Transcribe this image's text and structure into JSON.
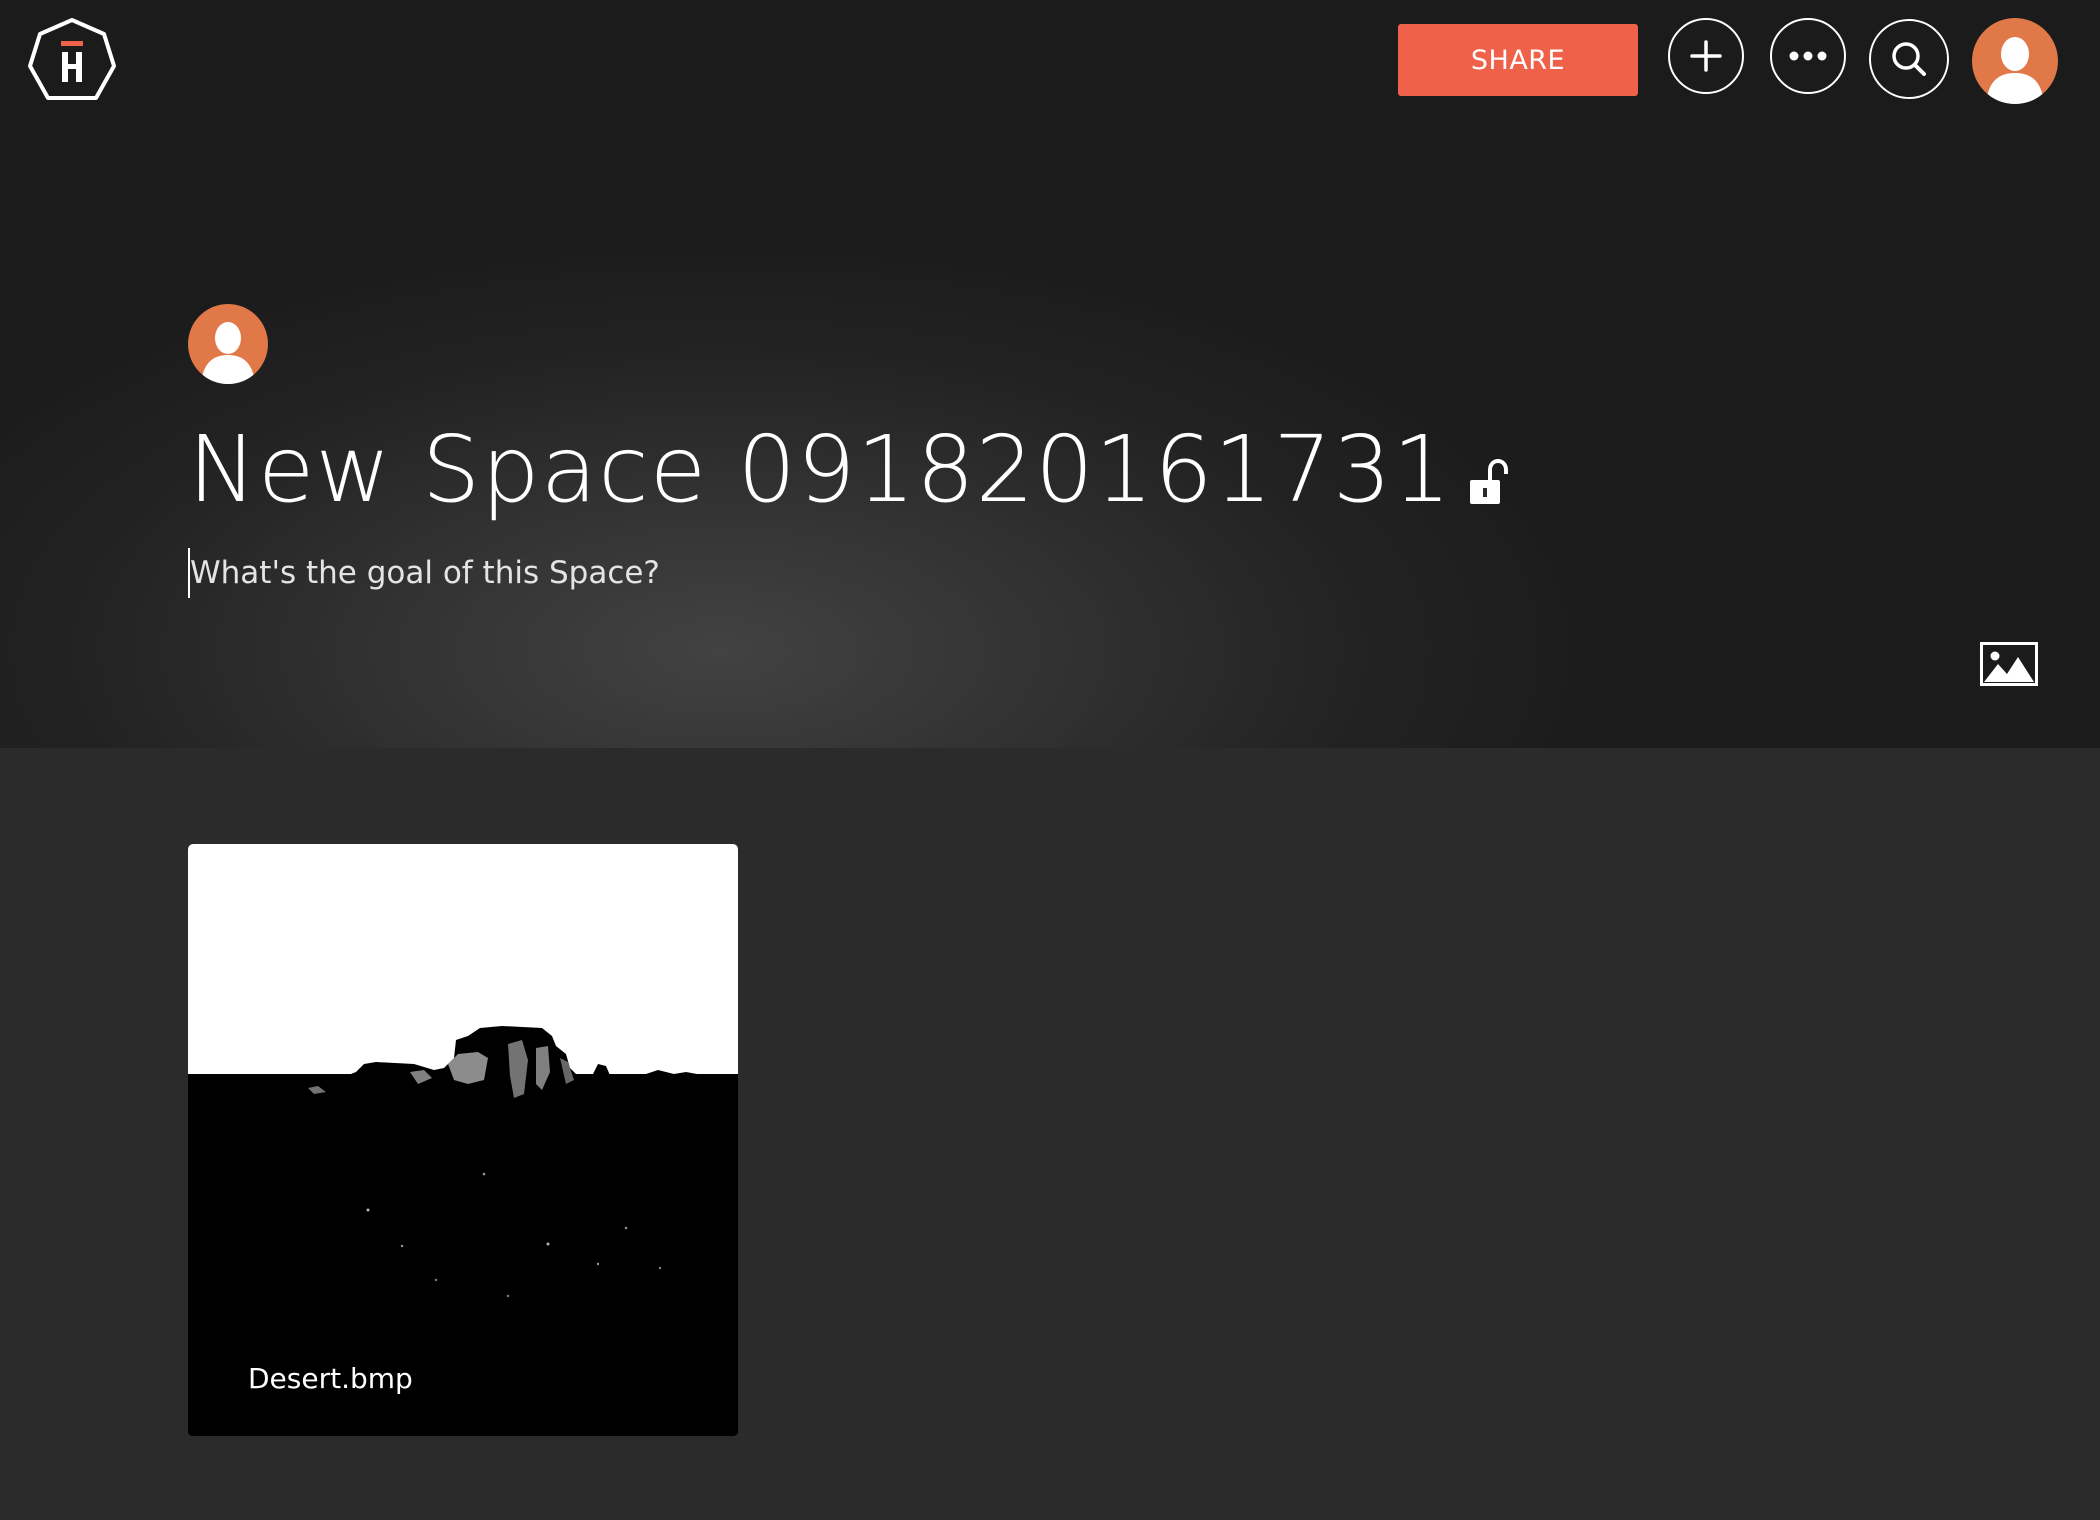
{
  "header": {
    "logo_icon": "app-logo-icon",
    "share_label": "SHARE",
    "add_icon": "plus-icon",
    "more_icon": "more-dots-icon",
    "search_icon": "search-icon",
    "avatar_icon": "user-avatar-icon"
  },
  "colors": {
    "accent": "#f0614a",
    "avatar": "#e07848",
    "background": "#2b2b2b",
    "hero_dark": "#1b1b1b"
  },
  "space": {
    "owner_avatar_icon": "user-avatar-icon",
    "title": "New Space 0918201617​31",
    "privacy_icon": "unlocked-icon",
    "goal_placeholder": "What's the goal of this Space?",
    "goal_value": "",
    "cover_icon": "image-icon"
  },
  "items": [
    {
      "name": "Desert.bmp",
      "thumbnail_icon": "desert-thumbnail"
    }
  ]
}
